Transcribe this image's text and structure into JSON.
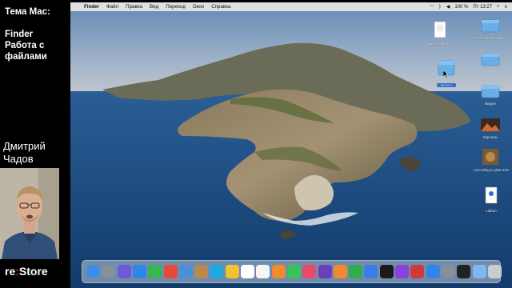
{
  "overlay": {
    "topic": "Тема Mac:",
    "title_lines": [
      "Finder",
      "Работа с",
      "файлами"
    ],
    "presenter_lines": [
      "Дмитрий",
      "Чадов"
    ],
    "brand_left": "re",
    "brand_colon": ":",
    "brand_right": "Store"
  },
  "menubar": {
    "apple": "",
    "items": [
      "Finder",
      "Файл",
      "Правка",
      "Вид",
      "Переход",
      "Окно",
      "Справка"
    ],
    "battery": "100 %",
    "clock": "Пт 13:27"
  },
  "desktop": {
    "items": [
      {
        "label": "Без названия",
        "icon": "document-icon"
      },
      {
        "label": "Фото 2",
        "icon": "folder-icon"
      },
      {
        "label": "Постоянная папка",
        "icon": "folder-icon"
      },
      {
        "label": "",
        "icon": "folder-icon"
      },
      {
        "label": "Видео",
        "icon": "folder-icon"
      },
      {
        "label": "Курсоры",
        "icon": "image-icon"
      },
      {
        "label": "According to plan.mov",
        "icon": "video-icon"
      },
      {
        "label": "Lisbon",
        "icon": "document-icon"
      }
    ]
  },
  "dock": {
    "apps": [
      "Finder",
      "Launchpad",
      "Siri",
      "Safari",
      "Messages",
      "Chrome",
      "Preview",
      "Contacts",
      "Skype",
      "Notes",
      "Calendar",
      "Reminders",
      "Photos",
      "FaceTime",
      "Music",
      "iMovie",
      "Books",
      "Numbers",
      "Keynote",
      "TV",
      "Podcasts",
      "Photo Booth",
      "App Store",
      "System Preferences",
      "Activity Monitor",
      "Downloads",
      "Trash"
    ]
  },
  "colors": {
    "menubar_bg": "#ececee",
    "sea": "#1d4f86",
    "sky_top": "#6b8fb9",
    "sky_bottom": "#c6c9cd",
    "brand_colon": "#e2231a"
  }
}
